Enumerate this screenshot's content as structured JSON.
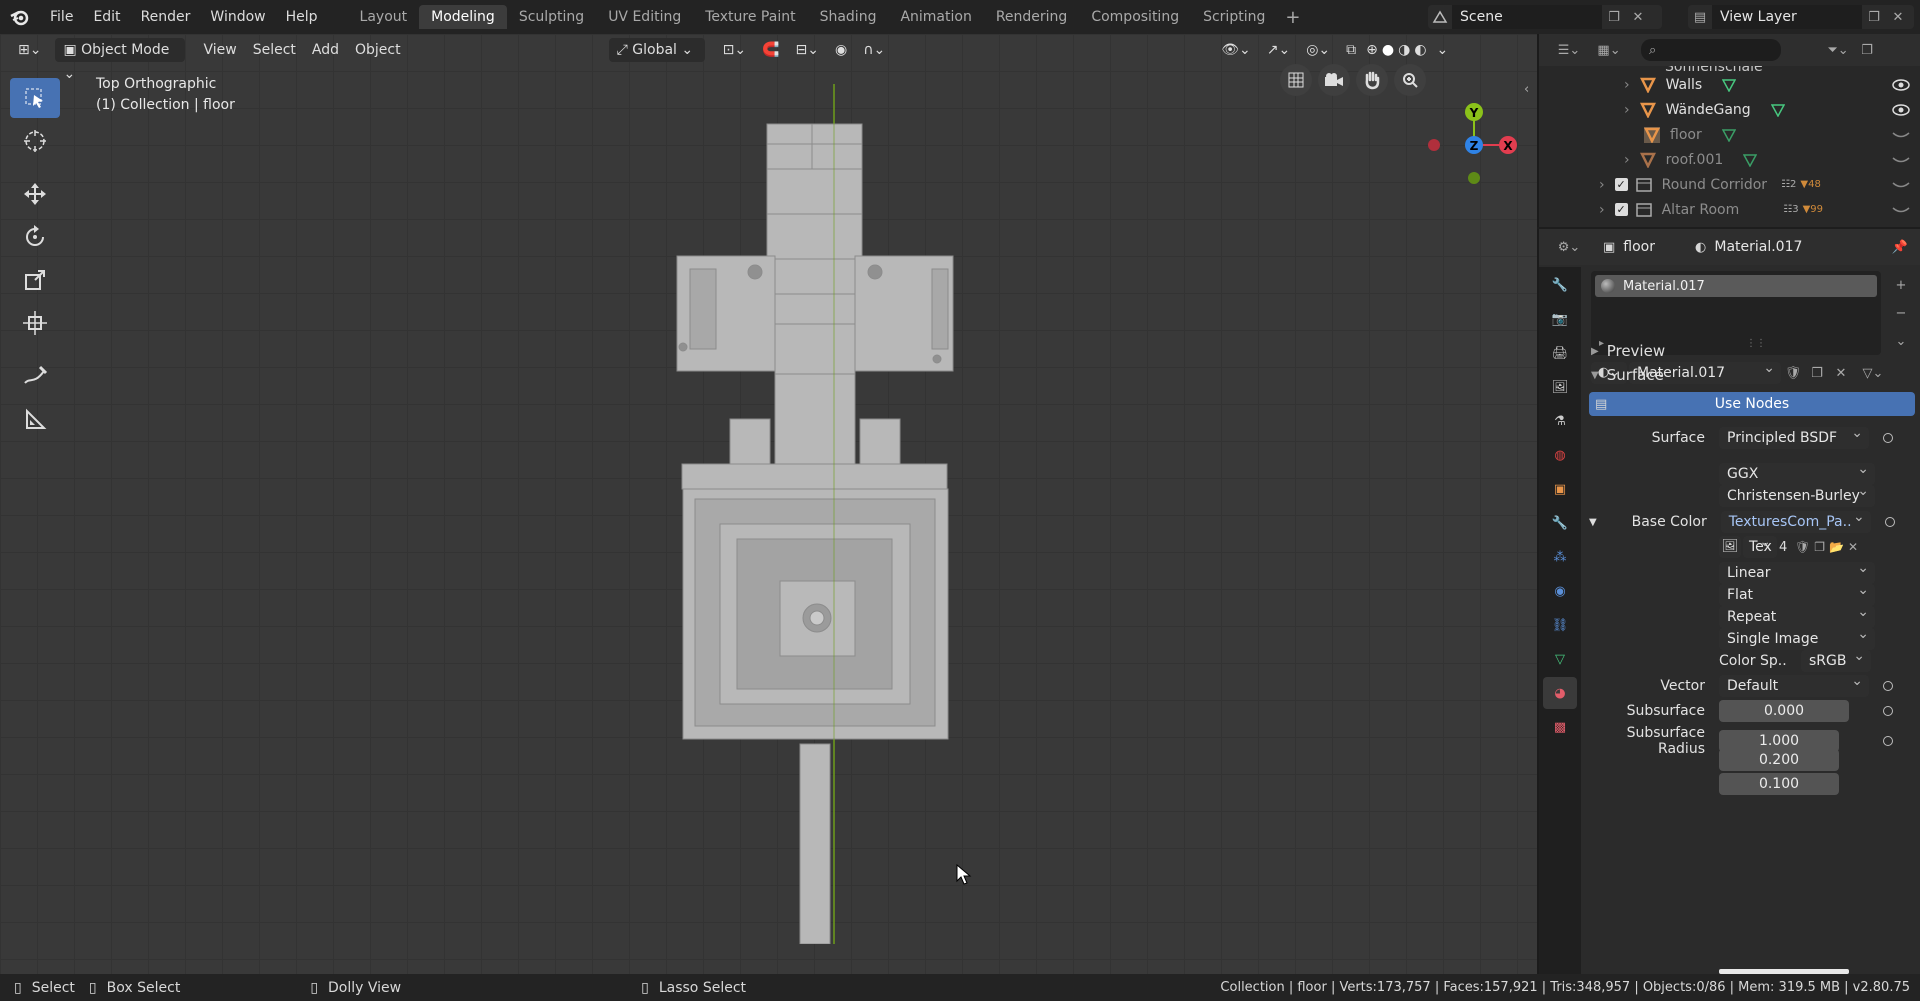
{
  "menu": [
    "File",
    "Edit",
    "Render",
    "Window",
    "Help"
  ],
  "workspaces": [
    "Layout",
    "Modeling",
    "Sculpting",
    "UV Editing",
    "Texture Paint",
    "Shading",
    "Animation",
    "Rendering",
    "Compositing",
    "Scripting"
  ],
  "active_workspace": "Modeling",
  "scene": "Scene",
  "view_layer": "View Layer",
  "viewport": {
    "mode": "Object Mode",
    "menus": [
      "View",
      "Select",
      "Add",
      "Object"
    ],
    "orientation": "Global",
    "view_name": "Top Orthographic",
    "collection_info": "(1) Collection | floor",
    "gizmo": {
      "y": "Y",
      "z": "Z",
      "x": "X"
    }
  },
  "outliner": {
    "partial_top": "Sonnenschale",
    "items": [
      {
        "name": "Walls"
      },
      {
        "name": "WändeGang"
      },
      {
        "name": "floor"
      },
      {
        "name": "roof.001"
      },
      {
        "name": "Round Corridor",
        "count_a": "2",
        "count_b": "48"
      },
      {
        "name": "Altar Room",
        "count_a": "3",
        "count_b": "99"
      }
    ]
  },
  "properties": {
    "object": "floor",
    "material": "Material.017",
    "slot": "Material.017",
    "material_field": "Material.017",
    "preview_label": "Preview",
    "surface_label": "Surface",
    "use_nodes": "Use Nodes",
    "surface_key": "Surface",
    "surface_value": "Principled BSDF",
    "distribution": "GGX",
    "subsurface_method": "Christensen-Burley",
    "base_color_key": "Base Color",
    "base_color_value": "TexturesCom_Pa..",
    "tex_label": "Tex",
    "tex_users": "4",
    "interpolation": "Linear",
    "projection": "Flat",
    "extension": "Repeat",
    "source": "Single Image",
    "color_space_key": "Color Sp..",
    "color_space_value": "sRGB",
    "vector_key": "Vector",
    "vector_value": "Default",
    "subsurface_key": "Subsurface",
    "subsurface_value": "0.000",
    "subsurface_radius_key": "Subsurface Radius",
    "subsurface_radius": [
      "1.000",
      "0.200",
      "0.100"
    ]
  },
  "status": {
    "select": "Select",
    "box_select": "Box Select",
    "dolly": "Dolly View",
    "lasso": "Lasso Select",
    "info": "Collection | floor | Verts:173,757 | Faces:157,921 | Tris:348,957 | Objects:0/86 | Mem: 319.5 MB | v2.80.75"
  },
  "colors": {
    "accent": "#4772b3",
    "active_tool": "#4772b3",
    "axis_x": "#e23d4f",
    "axis_y": "#8bc21a",
    "axis_z": "#2f83e6"
  }
}
